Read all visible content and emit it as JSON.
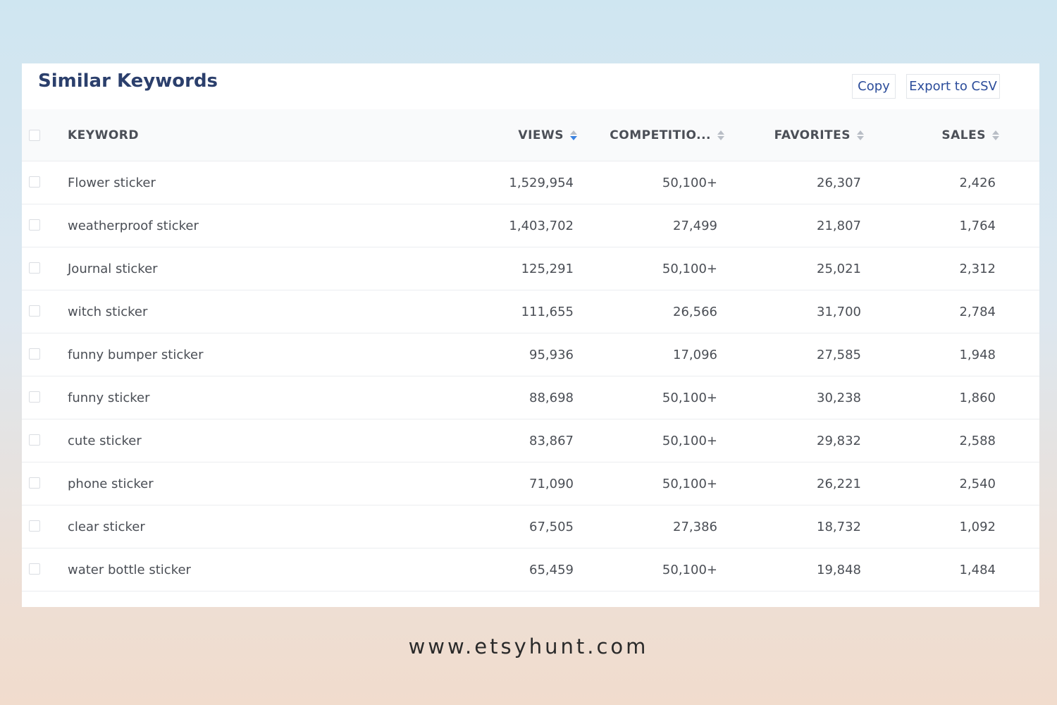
{
  "panel": {
    "title": "Similar Keywords",
    "copy_label": "Copy",
    "export_label": "Export to CSV"
  },
  "table": {
    "columns": {
      "keyword": "KEYWORD",
      "views": "VIEWS",
      "competition": "COMPETITIO...",
      "favorites": "FAVORITES",
      "sales": "SALES"
    },
    "active_sort": "views",
    "rows": [
      {
        "keyword": "Flower sticker",
        "views": "1,529,954",
        "competition": "50,100+",
        "favorites": "26,307",
        "sales": "2,426"
      },
      {
        "keyword": "weatherproof sticker",
        "views": "1,403,702",
        "competition": "27,499",
        "favorites": "21,807",
        "sales": "1,764"
      },
      {
        "keyword": "Journal sticker",
        "views": "125,291",
        "competition": "50,100+",
        "favorites": "25,021",
        "sales": "2,312"
      },
      {
        "keyword": "witch sticker",
        "views": "111,655",
        "competition": "26,566",
        "favorites": "31,700",
        "sales": "2,784"
      },
      {
        "keyword": "funny bumper sticker",
        "views": "95,936",
        "competition": "17,096",
        "favorites": "27,585",
        "sales": "1,948"
      },
      {
        "keyword": "funny sticker",
        "views": "88,698",
        "competition": "50,100+",
        "favorites": "30,238",
        "sales": "1,860"
      },
      {
        "keyword": "cute sticker",
        "views": "83,867",
        "competition": "50,100+",
        "favorites": "29,832",
        "sales": "2,588"
      },
      {
        "keyword": "phone sticker",
        "views": "71,090",
        "competition": "50,100+",
        "favorites": "26,221",
        "sales": "2,540"
      },
      {
        "keyword": "clear sticker",
        "views": "67,505",
        "competition": "27,386",
        "favorites": "18,732",
        "sales": "1,092"
      },
      {
        "keyword": "water bottle sticker",
        "views": "65,459",
        "competition": "50,100+",
        "favorites": "19,848",
        "sales": "1,484"
      }
    ]
  },
  "icons": {
    "sort": "sort-icon",
    "checkbox": "checkbox"
  },
  "colors": {
    "title": "#2b3f6c",
    "button_text": "#2b4c9a",
    "sort_active": "#3b82e0",
    "sort_inactive": "#b9bec6"
  },
  "footer": {
    "url": "www.etsyhunt.com"
  }
}
